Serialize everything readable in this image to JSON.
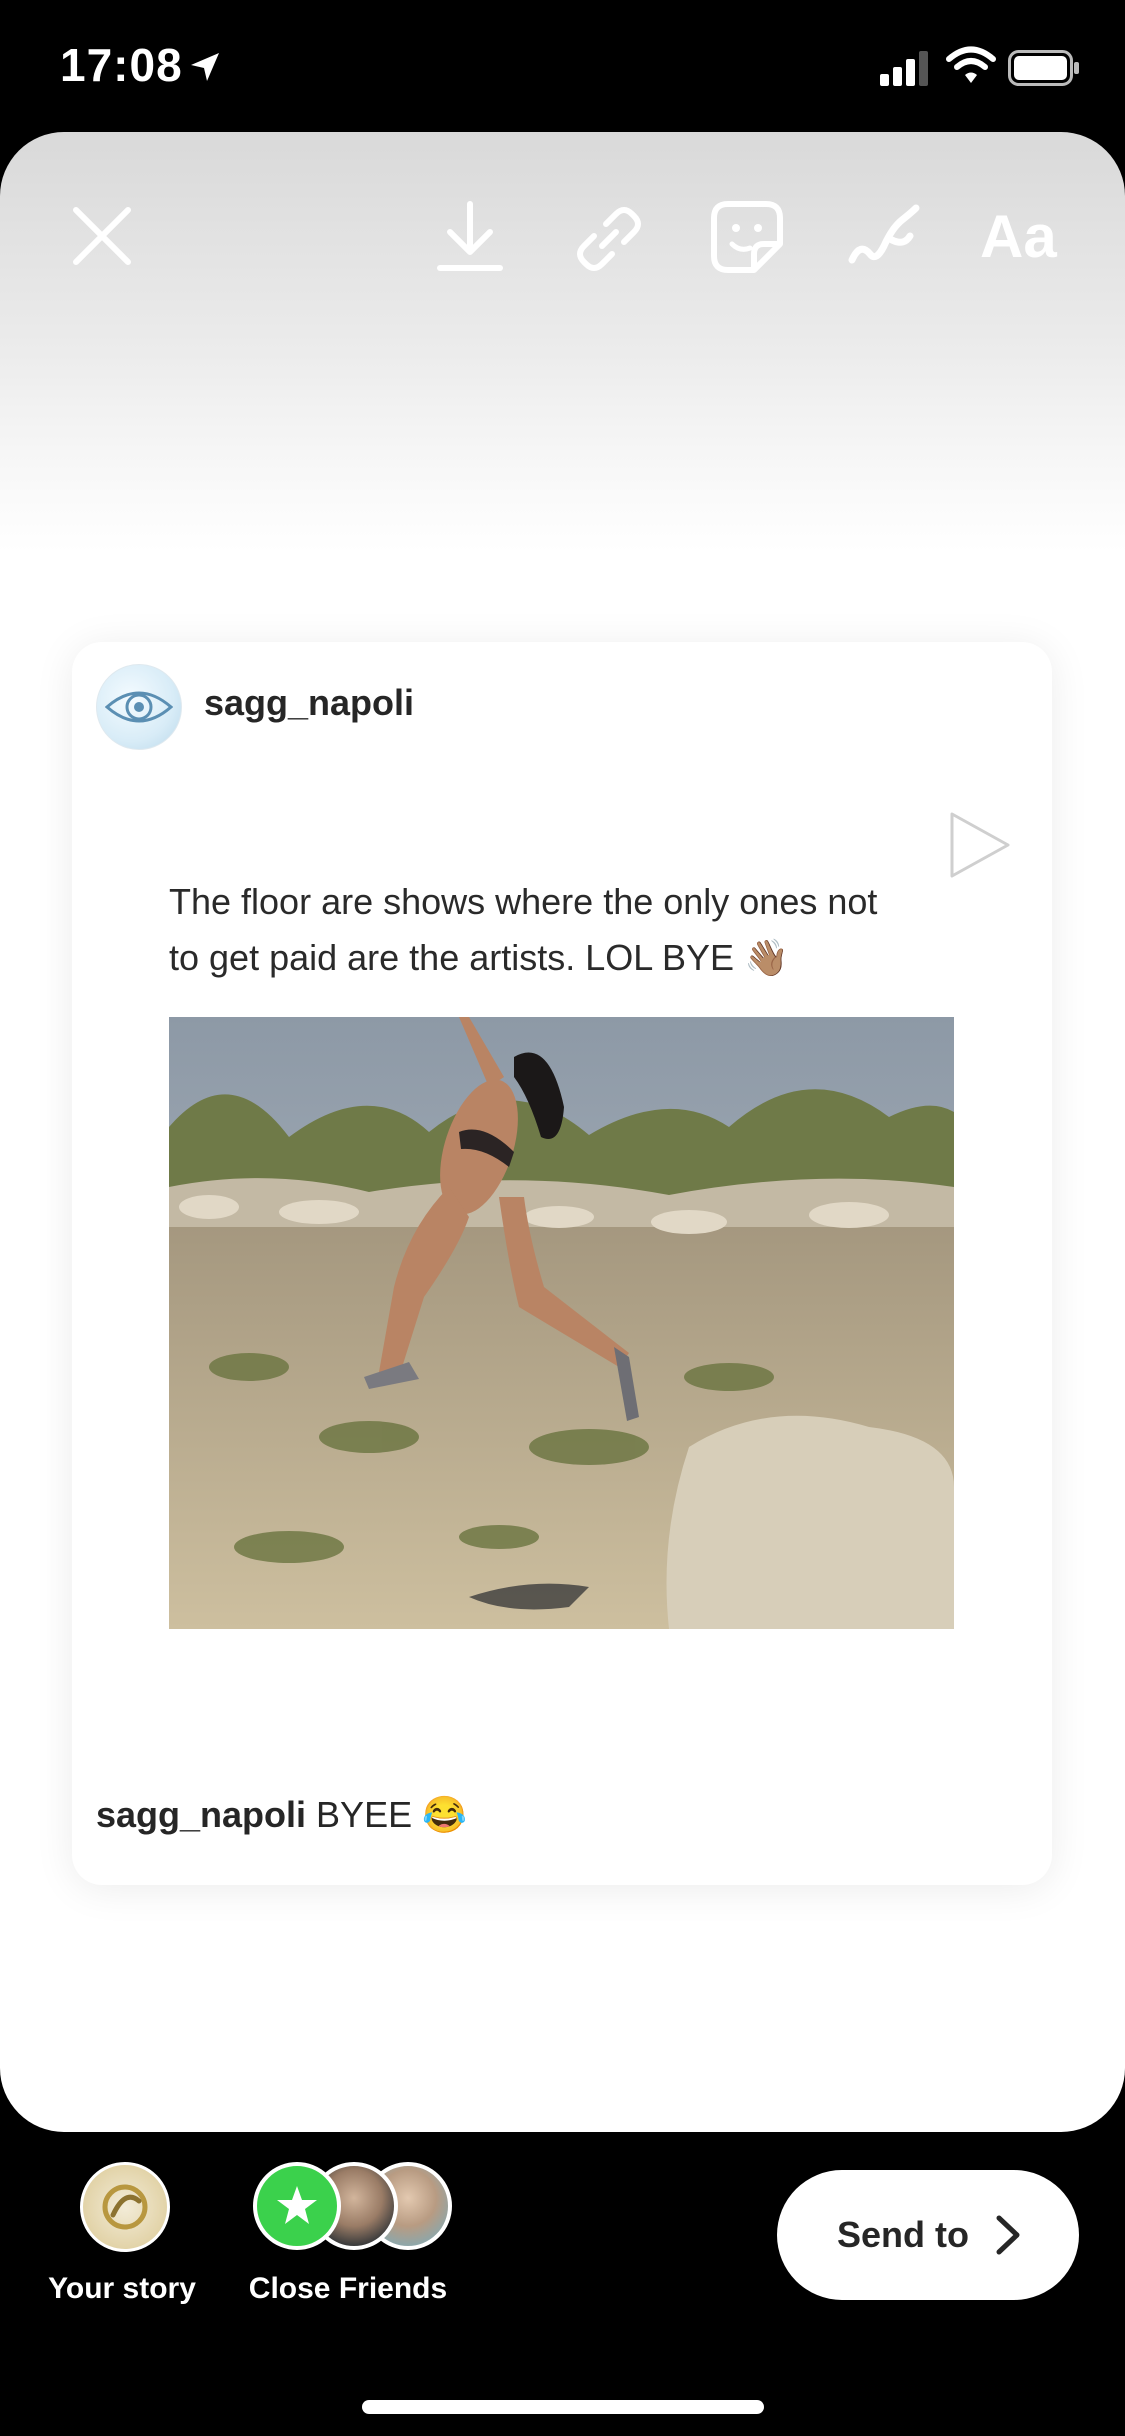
{
  "status_bar": {
    "time": "17:08",
    "icons": [
      "location-arrow-icon",
      "signal-icon",
      "wifi-icon",
      "battery-icon"
    ]
  },
  "editor_toolbar": {
    "text_tool_label": "Aa",
    "icons": [
      "close-icon",
      "download-icon",
      "link-icon",
      "sticker-icon",
      "draw-icon"
    ]
  },
  "post": {
    "username": "sagg_napoli",
    "text_line1": "The floor are shows where the only ones not",
    "text_line2": "to get paid are the artists. LOL BYE",
    "text_emoji": "👋🏽",
    "caption_user": "sagg_napoli",
    "caption_text": " BYEE ",
    "caption_emoji": "😂"
  },
  "share": {
    "your_story_label": "Your story",
    "close_friends_label": "Close Friends",
    "close_friends_color": "#3bd14c",
    "send_label": "Send to"
  }
}
